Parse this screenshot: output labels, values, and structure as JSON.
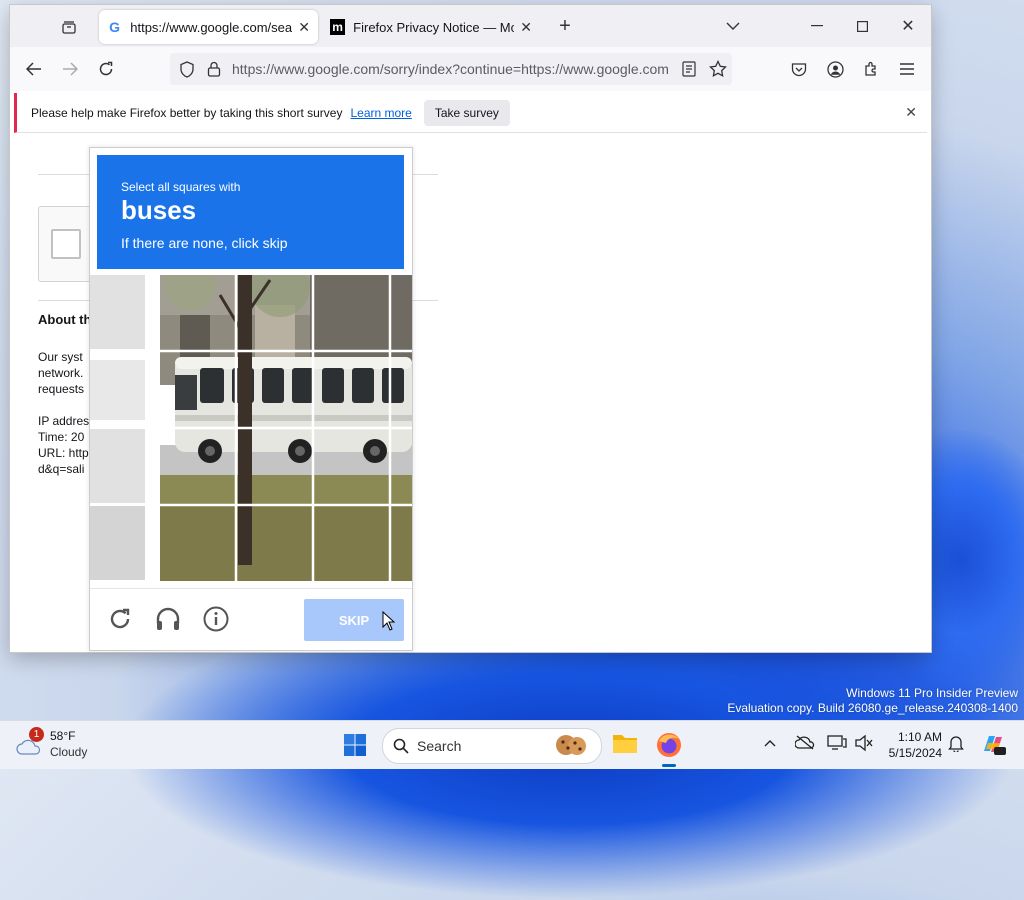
{
  "browser": {
    "tabs": [
      {
        "label": "https://www.google.com/search",
        "favicon": "google-favicon",
        "active": true
      },
      {
        "label": "Firefox Privacy Notice — Mozilla",
        "favicon": "mozilla-favicon",
        "active": false
      }
    ],
    "url": "https://www.google.com/sorry/index?continue=https://www.google.com"
  },
  "notification": {
    "message": "Please help make Firefox better by taking this short survey",
    "learn_more": "Learn more",
    "take_survey": "Take survey"
  },
  "page": {
    "about_heading": "About th",
    "para1": [
      "Our syst",
      "network.",
      "requests"
    ],
    "para2": [
      "IP addres",
      "Time: 20",
      "URL: http",
      "d&q=sali"
    ]
  },
  "captcha": {
    "instruction": "Select all squares with",
    "target": "buses",
    "hint": "If there are none, click skip",
    "skip_label": "SKIP",
    "header_color": "#1a73e8"
  },
  "wallpaper": {
    "watermark_line1": "Windows 11 Pro Insider Preview",
    "watermark_line2": "Evaluation copy. Build 26080.ge_release.240308-1400"
  },
  "taskbar": {
    "weather_temp": "58°F",
    "weather_desc": "Cloudy",
    "weather_badge": "1",
    "search_placeholder": "Search",
    "time": "1:10 AM",
    "date": "5/15/2024"
  }
}
